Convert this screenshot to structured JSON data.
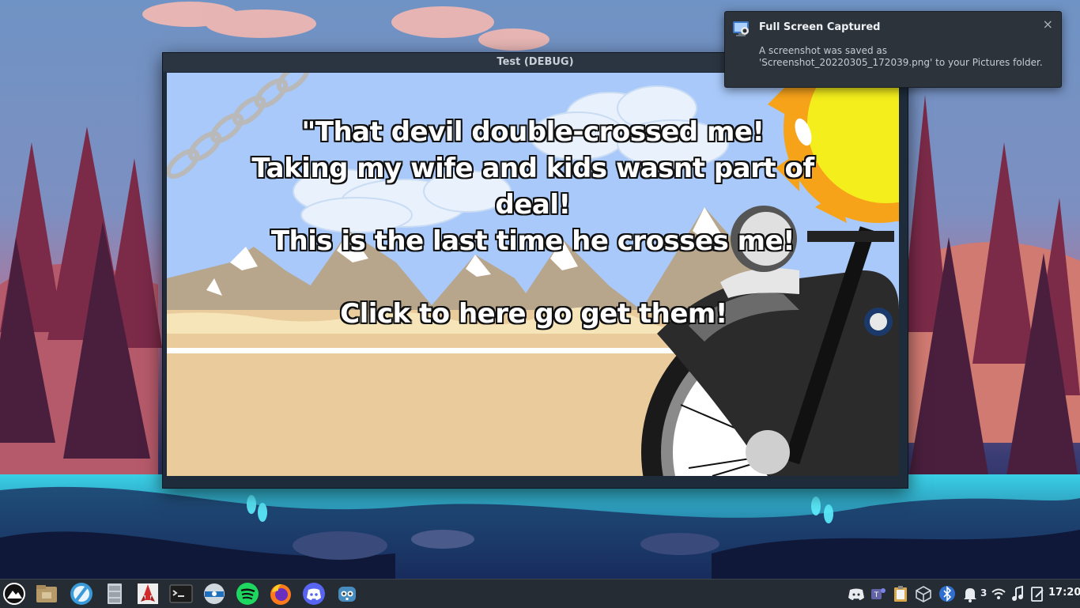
{
  "window": {
    "title": "Test (DEBUG)"
  },
  "game": {
    "dialog_lines": [
      "\"That devil double-crossed me!",
      "Taking my wife and kids wasnt part of",
      "deal!",
      "This is the last time he crosses me!"
    ],
    "call_to_action": "Click to here go get them!"
  },
  "notification": {
    "title": "Full Screen Captured",
    "body_line1": "A screenshot was saved as",
    "body_line2": "'Screenshot_20220305_172039.png' to your Pictures folder.",
    "close_symbol": "×"
  },
  "taskbar": {
    "launchers": [
      {
        "name": "app-launcher-icon"
      },
      {
        "name": "file-manager-icon"
      },
      {
        "name": "browser-globe-icon"
      },
      {
        "name": "file-cabinet-icon"
      },
      {
        "name": "rocket-app-icon"
      },
      {
        "name": "terminal-icon"
      },
      {
        "name": "disk-utility-icon"
      },
      {
        "name": "spotify-icon"
      },
      {
        "name": "firefox-icon"
      },
      {
        "name": "discord-icon"
      },
      {
        "name": "godot-icon"
      }
    ],
    "tray": {
      "notification_count": "3",
      "clock": "17:20"
    }
  },
  "colors": {
    "sky": "#9ec3f8",
    "sand": "#eacb9b",
    "sun": "#f4ee1c",
    "taskbar": "#262c33",
    "notification_bg": "#2d333b"
  }
}
